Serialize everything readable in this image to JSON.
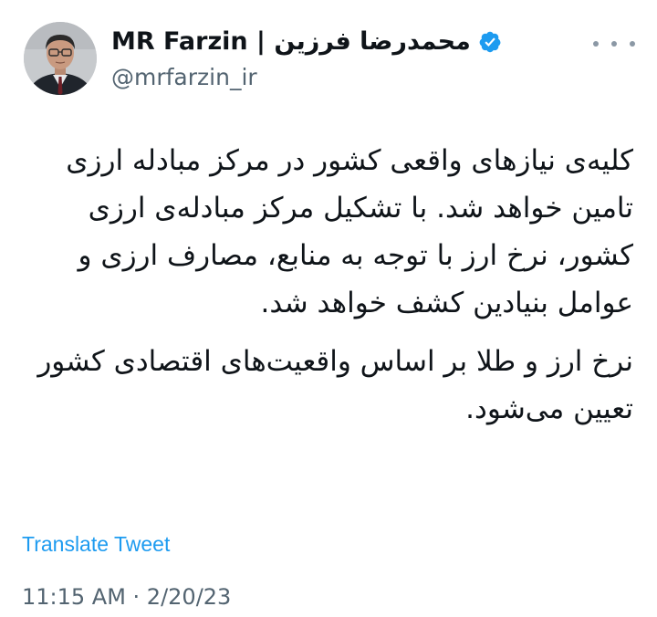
{
  "tweet": {
    "author": {
      "display_name": "MR Farzin | محمدرضا فرزین",
      "handle": "@mrfarzin_ir",
      "verified_icon": "verified-badge-icon"
    },
    "more_icon": "more-options-icon",
    "text": {
      "paragraph_1": "کلیه‌ی نیازهای واقعی کشور در مرکز مبادله ارزی تامین خواهد شد. با تشکیل مرکز مبادله‌ی ارزی کشور، نرخ ارز با توجه به منابع، مصارف ارزی و عوامل بنیادین کشف خواهد شد.",
      "paragraph_2": "نرخ ارز و طلا بر اساس واقعیت‌های اقتصادی کشور تعیین می‌شود."
    },
    "translate_label": "Translate Tweet",
    "timestamp": "11:15 AM · 2/20/23"
  },
  "colors": {
    "verified": "#1d9bf0",
    "link": "#1d9bf0",
    "muted": "#536471",
    "text": "#0f1419"
  }
}
